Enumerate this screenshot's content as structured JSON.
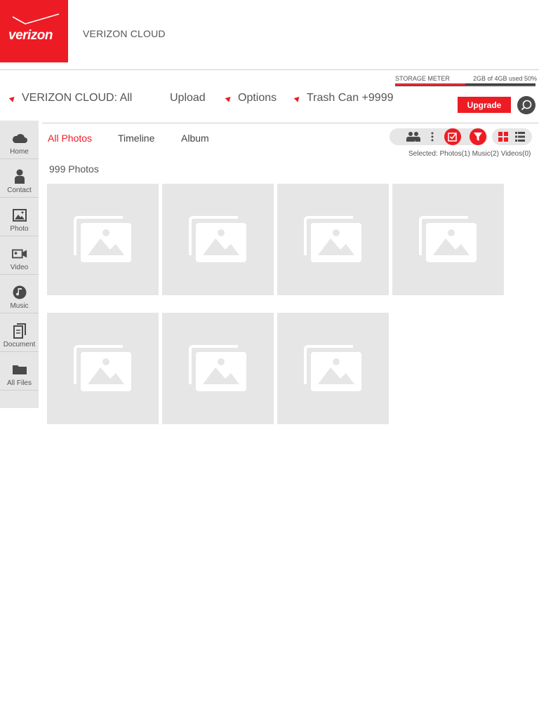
{
  "header": {
    "logo_text": "verizon",
    "app_title": "VERIZON CLOUD"
  },
  "storage": {
    "label": "STORAGE METER",
    "info": "2GB of 4GB used 50%",
    "used_fraction": 0.5
  },
  "menu": {
    "cloud_filter": "VERIZON CLOUD: All",
    "upload": "Upload",
    "options": "Options",
    "trash": "Trash Can +9999",
    "upgrade": "Upgrade"
  },
  "sidebar": {
    "items": [
      {
        "label": "Home",
        "icon": "cloud-icon"
      },
      {
        "label": "Contact",
        "icon": "person-icon"
      },
      {
        "label": "Photo",
        "icon": "photo-icon"
      },
      {
        "label": "Video",
        "icon": "video-icon"
      },
      {
        "label": "Music",
        "icon": "music-icon"
      },
      {
        "label": "Document",
        "icon": "document-icon"
      },
      {
        "label": "All Files",
        "icon": "folder-icon"
      }
    ]
  },
  "tabs": {
    "all_photos": "All Photos",
    "timeline": "Timeline",
    "album": "Album"
  },
  "toolbar": {
    "selected": "Selected: Photos(1) Music(2) Videos(0)"
  },
  "content": {
    "count": "999 Photos",
    "tile_icon": "image-placeholder-icon"
  },
  "colors": {
    "brand_red": "#ed1c24",
    "tile_gray": "#e6e6e6",
    "sidebar_gray": "#e6e6e6"
  }
}
